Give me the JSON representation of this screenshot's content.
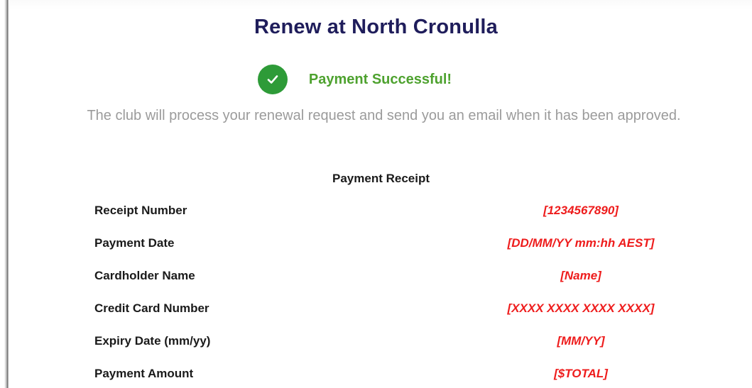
{
  "page": {
    "title": "Renew at North Cronulla",
    "status": {
      "icon": "check-circle-icon",
      "text": "Payment Successful!",
      "color": "#2e9b38"
    },
    "info_text": "The club will process your renewal request and send you an email when it has been approved."
  },
  "receipt": {
    "title": "Payment Receipt",
    "rows": [
      {
        "label": "Receipt Number",
        "value": "[1234567890]"
      },
      {
        "label": "Payment Date",
        "value": "[DD/MM/YY mm:hh AEST]"
      },
      {
        "label": "Cardholder Name",
        "value": "[Name]"
      },
      {
        "label": "Credit Card Number",
        "value": "[XXXX XXXX XXXX XXXX]"
      },
      {
        "label": "Expiry Date (mm/yy)",
        "value": "[MM/YY]"
      },
      {
        "label": "Payment Amount",
        "value": "[$TOTAL]"
      }
    ],
    "value_color": "#ee1c1c"
  }
}
